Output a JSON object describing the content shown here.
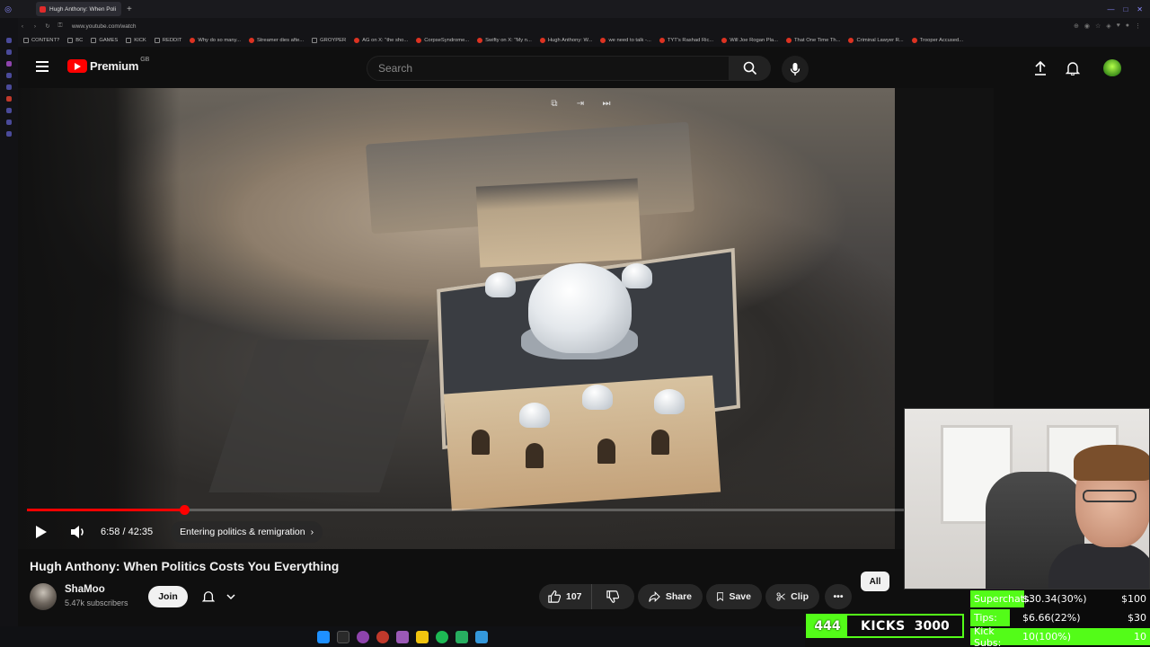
{
  "browser": {
    "tab_title": "Hugh Anthony: When Poli",
    "url": "www.youtube.com/watch",
    "bookmarks": [
      "CONTENT?",
      "BC",
      "GAMES",
      "KICK",
      "REDDIT",
      "Why do so many...",
      "Streamer dies afte...",
      "GROYPER",
      "AG on X: \"the sho...",
      "CorpseSyndrome...",
      "Swifty on X: \"My n...",
      "Hugh Anthony: W...",
      "we need to talk -...",
      "TYT's Rashad Ric...",
      "Will Joe Rogan Pla...",
      "That One Time Th...",
      "Criminal Lawyer R...",
      "Trooper Accused..."
    ]
  },
  "header": {
    "logo_text": "Premium",
    "country": "GB",
    "search_placeholder": "Search"
  },
  "player": {
    "time": "6:58 / 42:35",
    "chapter": "Entering politics & remigration",
    "progress_fraction": 0.164
  },
  "video": {
    "title": "Hugh Anthony: When Politics Costs You Everything",
    "channel": "ShaMoo",
    "subscribers": "5.47k subscribers",
    "join_label": "Join",
    "likes": "107",
    "share_label": "Share",
    "save_label": "Save",
    "clip_label": "Clip",
    "chip_all": "All"
  },
  "stream_overlay": {
    "kicks_count": "444",
    "kicks_label": "KICKS",
    "kicks_goal": "3000",
    "goals": [
      {
        "label": "Superchats:",
        "value": "$30.34(30%)",
        "target": "$100",
        "fraction": 0.3
      },
      {
        "label": "Tips:",
        "value": "$6.66(22%)",
        "target": "$30",
        "fraction": 0.22
      },
      {
        "label": "Kick Subs:",
        "value": "10(100%)",
        "target": "10",
        "fraction": 1.0
      }
    ]
  },
  "colors": {
    "yt_red": "#ff0000",
    "kick_green": "#53fc18",
    "background": "#0f0f0f"
  }
}
